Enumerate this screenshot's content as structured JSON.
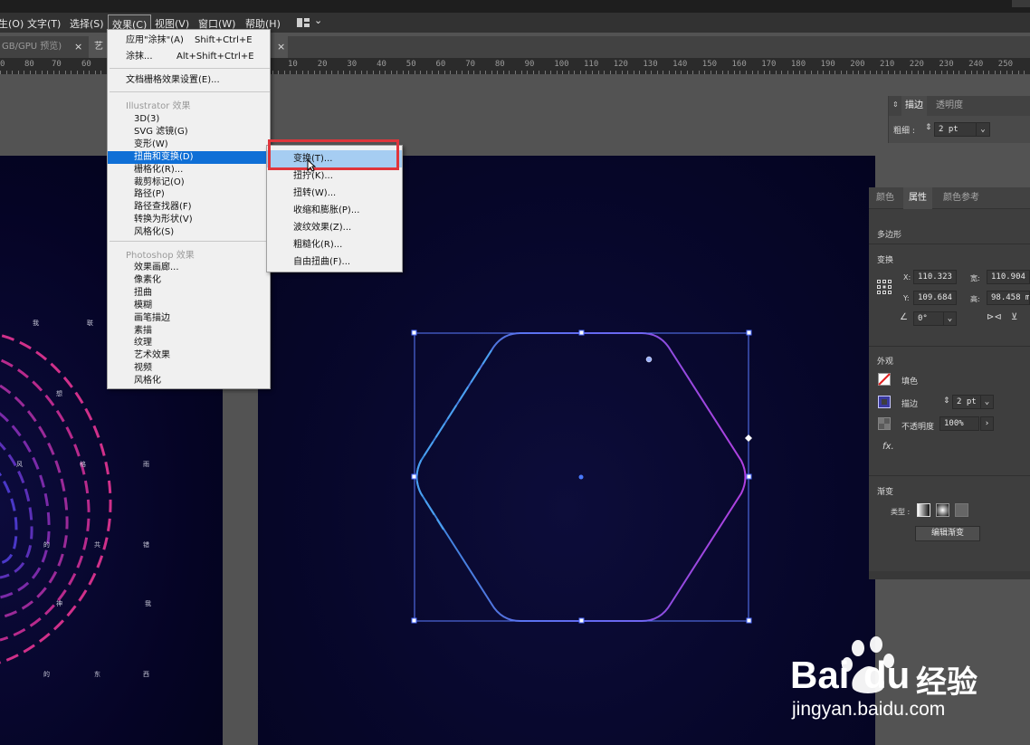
{
  "menubar": {
    "items": [
      "生(O)",
      "文字(T)",
      "选择(S)",
      "效果(C)",
      "视图(V)",
      "窗口(W)",
      "帮助(H)"
    ],
    "active_index": 3
  },
  "tabs": [
    {
      "label": "GB/GPU 预览)",
      "close": "×"
    },
    {
      "label": "艺",
      "close": "×"
    }
  ],
  "ruler": {
    "left_labels": [
      "0",
      "80",
      "70",
      "60"
    ],
    "right_labels": [
      "10",
      "20",
      "30",
      "40",
      "50",
      "60",
      "70",
      "80",
      "90",
      "100",
      "110",
      "120",
      "130",
      "140",
      "150",
      "160",
      "170",
      "180",
      "190",
      "200",
      "210",
      "220",
      "230",
      "240",
      "250"
    ]
  },
  "effect_menu": {
    "apply_last": {
      "label": "应用\"涂抹\"(A)",
      "shortcut": "Shift+Ctrl+E"
    },
    "last_effect": {
      "label": "涂抹...",
      "shortcut": "Alt+Shift+Ctrl+E"
    },
    "doc_raster": "文档栅格效果设置(E)...",
    "illustrator_header": "Illustrator 效果",
    "illustrator_items": [
      "3D(3)",
      "SVG 滤镜(G)",
      "变形(W)",
      "扭曲和变换(D)",
      "栅格化(R)...",
      "裁剪标记(O)",
      "路径(P)",
      "路径查找器(F)",
      "转换为形状(V)",
      "风格化(S)"
    ],
    "illustrator_highlight": 3,
    "photoshop_header": "Photoshop 效果",
    "photoshop_items": [
      "效果画廊...",
      "像素化",
      "扭曲",
      "模糊",
      "画笔描边",
      "素描",
      "纹理",
      "艺术效果",
      "视频",
      "风格化"
    ]
  },
  "submenu": {
    "items": [
      "变换(T)...",
      "扭拧(K)...",
      "扭转(W)...",
      "收缩和膨胀(P)...",
      "波纹效果(Z)...",
      "粗糙化(R)...",
      "自由扭曲(F)..."
    ],
    "highlight": 0
  },
  "stroke_panel": {
    "tabs": [
      "描边",
      "透明度"
    ],
    "weight_label": "粗细 :",
    "weight_value": "2 pt"
  },
  "props_panel": {
    "tabs": [
      "颜色",
      "属性",
      "颜色参考"
    ],
    "active_tab": 1,
    "object_type": "多边形",
    "transform_title": "变换",
    "x_label": "X:",
    "x_value": "110.323",
    "w_label": "宽:",
    "w_value": "110.904",
    "y_label": "Y:",
    "y_value": "109.684",
    "h_label": "高:",
    "h_value": "98.458 m",
    "angle_value": "0°",
    "appearance_title": "外观",
    "fill_label": "填色",
    "stroke_label": "描边",
    "stroke_value": "2 pt",
    "opacity_label": "不透明度",
    "opacity_value": "100%",
    "fx_label": "fx.",
    "gradient_title": "渐变",
    "gradient_type_label": "类型 :",
    "edit_gradient_label": "编辑渐变"
  },
  "artwork_left_chars": [
    "我",
    "联",
    "想",
    "风",
    "格",
    "雨",
    "的",
    "共",
    "错",
    "神",
    "我",
    "的",
    "东",
    "西"
  ],
  "watermark": {
    "brand": "Bai",
    "brand2": "du",
    "product": "经验",
    "url": "jingyan.baidu.com"
  },
  "colors": {
    "accent_blue": "#0f6fd6",
    "hover_blue": "#a6cdf2",
    "highlight_red": "#e0353b",
    "artboard": "#07072b",
    "dash_pink": "#d0308a"
  }
}
